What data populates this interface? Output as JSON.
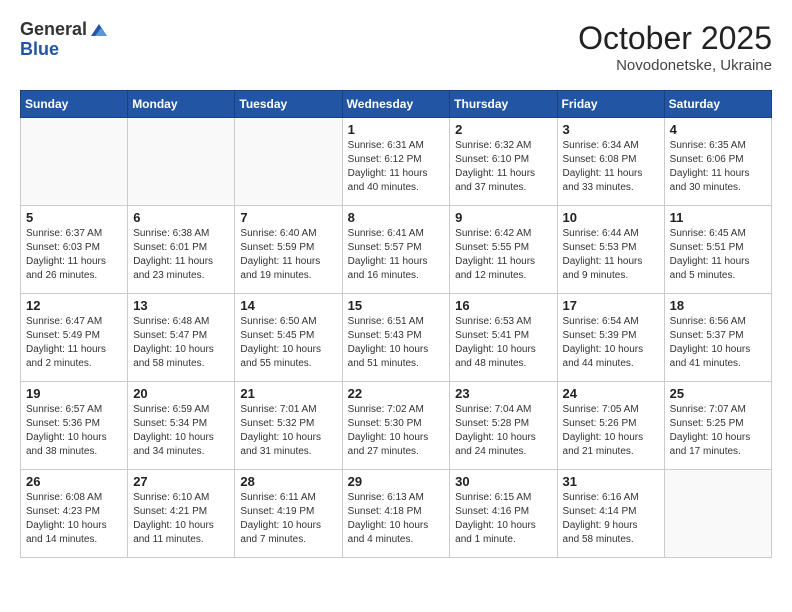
{
  "logo": {
    "general": "General",
    "blue": "Blue"
  },
  "header": {
    "month": "October 2025",
    "location": "Novodonetske, Ukraine"
  },
  "weekdays": [
    "Sunday",
    "Monday",
    "Tuesday",
    "Wednesday",
    "Thursday",
    "Friday",
    "Saturday"
  ],
  "weeks": [
    [
      {
        "day": "",
        "info": ""
      },
      {
        "day": "",
        "info": ""
      },
      {
        "day": "",
        "info": ""
      },
      {
        "day": "1",
        "info": "Sunrise: 6:31 AM\nSunset: 6:12 PM\nDaylight: 11 hours\nand 40 minutes."
      },
      {
        "day": "2",
        "info": "Sunrise: 6:32 AM\nSunset: 6:10 PM\nDaylight: 11 hours\nand 37 minutes."
      },
      {
        "day": "3",
        "info": "Sunrise: 6:34 AM\nSunset: 6:08 PM\nDaylight: 11 hours\nand 33 minutes."
      },
      {
        "day": "4",
        "info": "Sunrise: 6:35 AM\nSunset: 6:06 PM\nDaylight: 11 hours\nand 30 minutes."
      }
    ],
    [
      {
        "day": "5",
        "info": "Sunrise: 6:37 AM\nSunset: 6:03 PM\nDaylight: 11 hours\nand 26 minutes."
      },
      {
        "day": "6",
        "info": "Sunrise: 6:38 AM\nSunset: 6:01 PM\nDaylight: 11 hours\nand 23 minutes."
      },
      {
        "day": "7",
        "info": "Sunrise: 6:40 AM\nSunset: 5:59 PM\nDaylight: 11 hours\nand 19 minutes."
      },
      {
        "day": "8",
        "info": "Sunrise: 6:41 AM\nSunset: 5:57 PM\nDaylight: 11 hours\nand 16 minutes."
      },
      {
        "day": "9",
        "info": "Sunrise: 6:42 AM\nSunset: 5:55 PM\nDaylight: 11 hours\nand 12 minutes."
      },
      {
        "day": "10",
        "info": "Sunrise: 6:44 AM\nSunset: 5:53 PM\nDaylight: 11 hours\nand 9 minutes."
      },
      {
        "day": "11",
        "info": "Sunrise: 6:45 AM\nSunset: 5:51 PM\nDaylight: 11 hours\nand 5 minutes."
      }
    ],
    [
      {
        "day": "12",
        "info": "Sunrise: 6:47 AM\nSunset: 5:49 PM\nDaylight: 11 hours\nand 2 minutes."
      },
      {
        "day": "13",
        "info": "Sunrise: 6:48 AM\nSunset: 5:47 PM\nDaylight: 10 hours\nand 58 minutes."
      },
      {
        "day": "14",
        "info": "Sunrise: 6:50 AM\nSunset: 5:45 PM\nDaylight: 10 hours\nand 55 minutes."
      },
      {
        "day": "15",
        "info": "Sunrise: 6:51 AM\nSunset: 5:43 PM\nDaylight: 10 hours\nand 51 minutes."
      },
      {
        "day": "16",
        "info": "Sunrise: 6:53 AM\nSunset: 5:41 PM\nDaylight: 10 hours\nand 48 minutes."
      },
      {
        "day": "17",
        "info": "Sunrise: 6:54 AM\nSunset: 5:39 PM\nDaylight: 10 hours\nand 44 minutes."
      },
      {
        "day": "18",
        "info": "Sunrise: 6:56 AM\nSunset: 5:37 PM\nDaylight: 10 hours\nand 41 minutes."
      }
    ],
    [
      {
        "day": "19",
        "info": "Sunrise: 6:57 AM\nSunset: 5:36 PM\nDaylight: 10 hours\nand 38 minutes."
      },
      {
        "day": "20",
        "info": "Sunrise: 6:59 AM\nSunset: 5:34 PM\nDaylight: 10 hours\nand 34 minutes."
      },
      {
        "day": "21",
        "info": "Sunrise: 7:01 AM\nSunset: 5:32 PM\nDaylight: 10 hours\nand 31 minutes."
      },
      {
        "day": "22",
        "info": "Sunrise: 7:02 AM\nSunset: 5:30 PM\nDaylight: 10 hours\nand 27 minutes."
      },
      {
        "day": "23",
        "info": "Sunrise: 7:04 AM\nSunset: 5:28 PM\nDaylight: 10 hours\nand 24 minutes."
      },
      {
        "day": "24",
        "info": "Sunrise: 7:05 AM\nSunset: 5:26 PM\nDaylight: 10 hours\nand 21 minutes."
      },
      {
        "day": "25",
        "info": "Sunrise: 7:07 AM\nSunset: 5:25 PM\nDaylight: 10 hours\nand 17 minutes."
      }
    ],
    [
      {
        "day": "26",
        "info": "Sunrise: 6:08 AM\nSunset: 4:23 PM\nDaylight: 10 hours\nand 14 minutes."
      },
      {
        "day": "27",
        "info": "Sunrise: 6:10 AM\nSunset: 4:21 PM\nDaylight: 10 hours\nand 11 minutes."
      },
      {
        "day": "28",
        "info": "Sunrise: 6:11 AM\nSunset: 4:19 PM\nDaylight: 10 hours\nand 7 minutes."
      },
      {
        "day": "29",
        "info": "Sunrise: 6:13 AM\nSunset: 4:18 PM\nDaylight: 10 hours\nand 4 minutes."
      },
      {
        "day": "30",
        "info": "Sunrise: 6:15 AM\nSunset: 4:16 PM\nDaylight: 10 hours\nand 1 minute."
      },
      {
        "day": "31",
        "info": "Sunrise: 6:16 AM\nSunset: 4:14 PM\nDaylight: 9 hours\nand 58 minutes."
      },
      {
        "day": "",
        "info": ""
      }
    ]
  ]
}
